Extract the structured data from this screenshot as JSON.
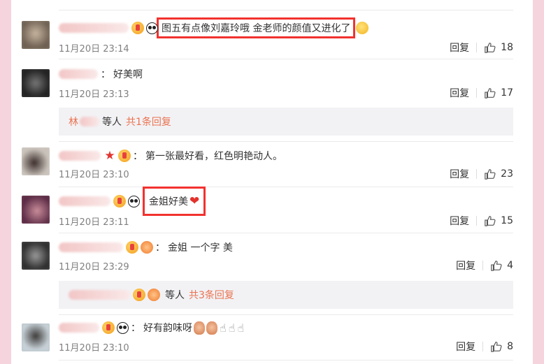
{
  "comments": [
    {
      "text": "图五有点像刘嘉玲哦 金老师的颜值又进化了",
      "time": "11月20日 23:14",
      "reply": "回复",
      "likes": "18"
    },
    {
      "text": "好美啊",
      "time": "11月20日 23:13",
      "reply": "回复",
      "likes": "17",
      "sub": {
        "name": "林",
        "mid": "等人",
        "count": "共1条回复"
      }
    },
    {
      "text": "第一张最好看，红色明艳动人。",
      "time": "11月20日 23:10",
      "reply": "回复",
      "likes": "23"
    },
    {
      "text": "金姐好美",
      "time": "11月20日 23:11",
      "reply": "回复",
      "likes": "15"
    },
    {
      "text": "金姐 一个字 美",
      "time": "11月20日 23:29",
      "reply": "回复",
      "likes": "4",
      "sub": {
        "mid": "等人",
        "count": "共3条回复"
      }
    },
    {
      "text": "好有韵味呀",
      "time": "11月20日 23:10",
      "reply": "回复",
      "likes": "8"
    }
  ],
  "colors": {
    "accent": "#eb7350",
    "highlight": "#f2322f",
    "bg": "#f6d4dd"
  }
}
